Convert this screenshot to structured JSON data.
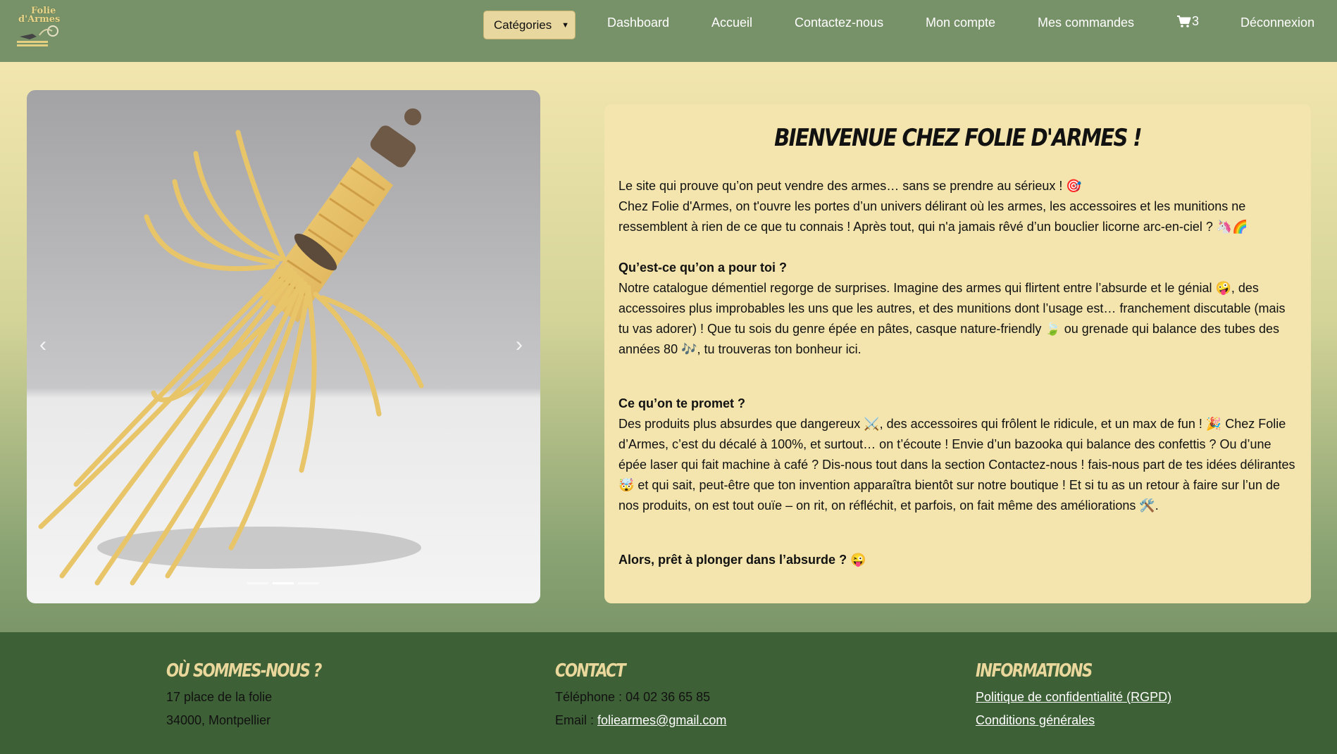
{
  "nav": {
    "logo_text_1": "Folie",
    "logo_text_2": "d'Armes",
    "categories_label": "Catégories",
    "links": [
      "Dashboard",
      "Accueil",
      "Contactez-nous",
      "Mon compte",
      "Mes commandes"
    ],
    "cart_count": "3",
    "logout": "Déconnexion"
  },
  "carousel": {
    "prev_icon": "‹",
    "next_icon": "›",
    "slide_count": 3,
    "active_index": 1
  },
  "welcome": {
    "title": "Bienvenue chez Folie d'Armes !",
    "intro_1": "Le site qui prouve qu’on peut vendre des armes… sans se prendre au sérieux ! 🎯",
    "intro_2": "Chez Folie d'Armes, on t'ouvre les portes d’un univers délirant où les armes, les accessoires et les munitions ne ressemblent à rien de ce que tu connais ! Après tout, qui n'a jamais rêvé d’un bouclier licorne arc-en-ciel ? 🦄🌈",
    "section1_title": "Qu’est-ce qu’on a pour toi ?",
    "section1_text": "Notre catalogue démentiel regorge de surprises. Imagine des armes qui flirtent entre l’absurde et le génial 🤪, des accessoires plus improbables les uns que les autres, et des munitions dont l’usage est… franchement discutable (mais tu vas adorer) ! Que tu sois du genre épée en pâtes, casque nature-friendly 🍃 ou grenade qui balance des tubes des années 80 🎶, tu trouveras ton bonheur ici.",
    "section2_title": "Ce qu’on te promet ?",
    "section2_text": "Des produits plus absurdes que dangereux ⚔️, des accessoires qui frôlent le ridicule, et un max de fun ! 🎉 Chez Folie d’Armes, c’est du décalé à 100%, et surtout… on t’écoute ! Envie d’un bazooka qui balance des confettis ? Ou d’une épée laser qui fait machine à café ? Dis-nous tout dans la section Contactez-nous ! fais-nous part de tes idées délirantes 🤯 et qui sait, peut-être que ton invention apparaîtra bientôt sur notre boutique ! Et si tu as un retour à faire sur l’un de nos produits, on est tout ouïe – on rit, on réfléchit, et parfois, on fait même des améliorations 🛠️.",
    "closing": "Alors, prêt à plonger dans l’absurde ? 😜"
  },
  "footer": {
    "where_title": "Où sommes-nous ?",
    "address_1": "17 place de la folie",
    "address_2": "34000, Montpellier",
    "contact_title": "Contact",
    "phone": "Téléphone : 04 02 36 65 85",
    "email_label": "Email : ",
    "email": "foliearmes@gmail.com",
    "info_title": "Informations",
    "privacy": "Politique de confidentialité (RGPD)",
    "terms": "Conditions générales"
  }
}
